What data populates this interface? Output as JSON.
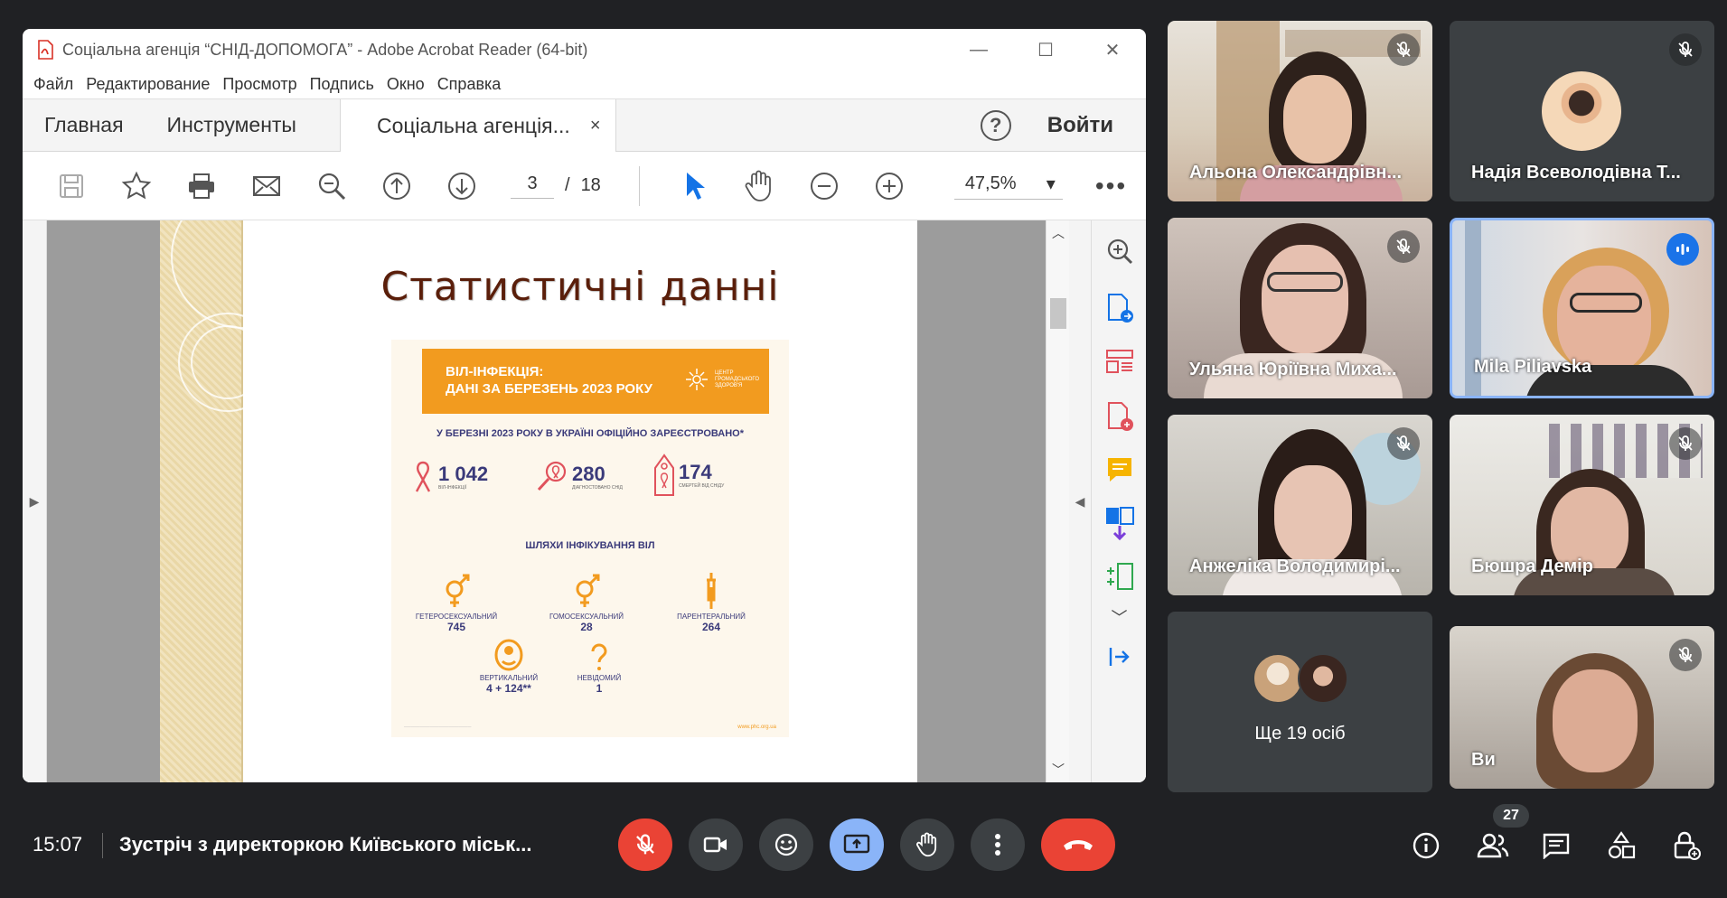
{
  "acrobat": {
    "title": "Соціальна агенція “СНІД-ДОПОМОГА” - Adobe Acrobat Reader (64-bit)",
    "menu": [
      "Файл",
      "Редактирование",
      "Просмотр",
      "Подпись",
      "Окно",
      "Справка"
    ],
    "tabs": {
      "home": "Главная",
      "tools": "Инструменты",
      "doc": "Соціальна агенція...",
      "close": "×"
    },
    "login": "Войти",
    "page_current": "3",
    "page_sep": "/",
    "page_total": "18",
    "zoom": "47,5%"
  },
  "slide": {
    "title": "Статистичні данні",
    "head_line1": "ВІЛ-ІНФЕКЦІЯ:",
    "head_line2": "ДАНІ ЗА БЕРЕЗЕНЬ 2023 РОКУ",
    "logo_text": "ЦЕНТР ГРОМАДСЬКОГО ЗДОРОВ'Я",
    "subtitle": "У БЕРЕЗНІ 2023 РОКУ В УКРАЇНІ ОФІЦІЙНО ЗАРЕЄСТРОВАНО*",
    "stats": [
      {
        "num": "1 042",
        "label": "ВІЛ-ІНФЕКЦІЇ"
      },
      {
        "num": "280",
        "label": "ДІАГНОСТОВАНО СНІД"
      },
      {
        "num": "174",
        "label": "СМЕРТЕЙ ВІД СНІДУ"
      }
    ],
    "routes_title": "ШЛЯХИ ІНФІКУВАННЯ ВІЛ",
    "routes": [
      {
        "label": "ГЕТЕРОСЕКСУАЛЬНИЙ",
        "value": "745"
      },
      {
        "label": "ГОМОСЕКСУАЛЬНИЙ",
        "value": "28"
      },
      {
        "label": "ПАРЕНТЕРАЛЬНИЙ",
        "value": "264"
      },
      {
        "label": "ВЕРТИКАЛЬНИЙ",
        "value": "4 + 124**"
      },
      {
        "label": "НЕВІДОМИЙ",
        "value": "1"
      }
    ],
    "site": "www.phc.org.ua"
  },
  "participants": [
    {
      "name": "Альона Олександрівн..."
    },
    {
      "name": "Надія Всеволодівна Т..."
    },
    {
      "name": "Ульяна Юріївна Миха..."
    },
    {
      "name": "Mila Piliavska"
    },
    {
      "name": "Анжеліка Володимирі..."
    },
    {
      "name": "Бюшра Демір"
    },
    {
      "name": "Ще 19 осіб"
    },
    {
      "name": "Ви"
    }
  ],
  "meeting": {
    "time": "15:07",
    "title": "Зустріч з директоркою Київського міськ...",
    "participant_count": "27"
  }
}
